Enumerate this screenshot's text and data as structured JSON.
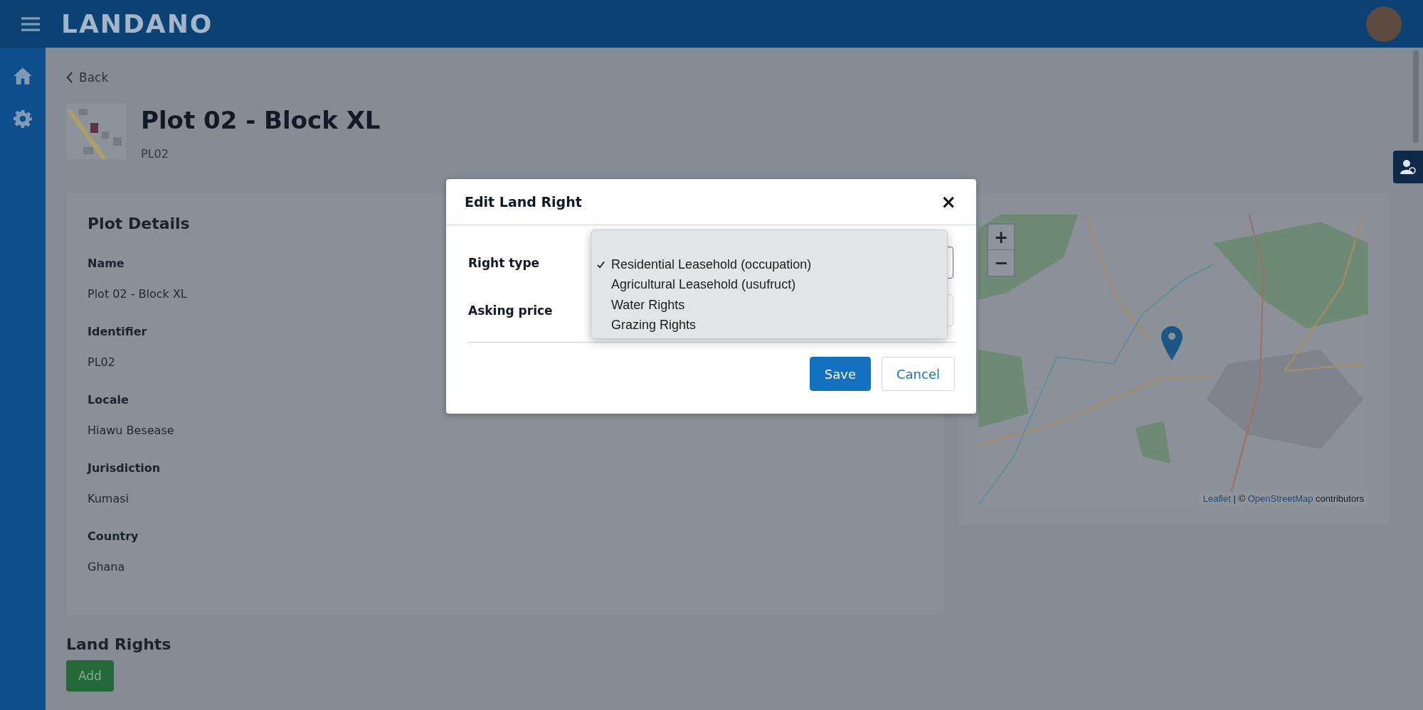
{
  "app": {
    "logo": "LANDANO"
  },
  "back": "Back",
  "plot": {
    "title": "Plot 02 - Block XL",
    "identifier": "PL02"
  },
  "details": {
    "title": "Plot Details",
    "fields": [
      {
        "label": "Name",
        "value": "Plot 02 - Block XL"
      },
      {
        "label": "Identifier",
        "value": "PL02"
      },
      {
        "label": "Locale",
        "value": "Hiawu Besease"
      },
      {
        "label": "Jurisdiction",
        "value": "Kumasi"
      },
      {
        "label": "Country",
        "value": "Ghana"
      }
    ]
  },
  "map": {
    "zoom_in": "+",
    "zoom_out": "−",
    "attribution": {
      "leaflet": "Leaflet",
      "separator": "| ©",
      "osm": "OpenStreetMap",
      "suffix": "contributors"
    }
  },
  "land_rights": {
    "title": "Land Rights",
    "add": "Add"
  },
  "modal": {
    "title": "Edit Land Right",
    "close": "×",
    "fields": [
      {
        "label": "Right type",
        "kind": "select"
      },
      {
        "label": "Asking price",
        "kind": "input"
      }
    ],
    "options": [
      {
        "label": "Residential Leasehold (occupation)",
        "selected": true
      },
      {
        "label": "Agricultural Leasehold (usufruct)",
        "selected": false
      },
      {
        "label": "Water Rights",
        "selected": false
      },
      {
        "label": "Grazing Rights",
        "selected": false
      }
    ],
    "buttons": [
      {
        "label": "Save",
        "kind": "primary"
      },
      {
        "label": "Cancel",
        "kind": "secondary"
      }
    ]
  }
}
